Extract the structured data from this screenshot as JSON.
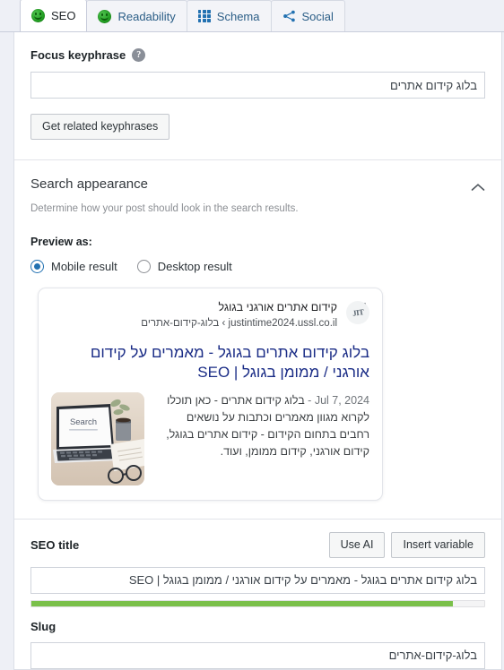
{
  "tabs": [
    {
      "id": "seo",
      "label": "SEO",
      "icon": "smiley-green-icon",
      "active": true
    },
    {
      "id": "readability",
      "label": "Readability",
      "icon": "smiley-green-icon",
      "active": false
    },
    {
      "id": "schema",
      "label": "Schema",
      "icon": "grid-icon",
      "active": false
    },
    {
      "id": "social",
      "label": "Social",
      "icon": "share-icon",
      "active": false
    }
  ],
  "focus_keyphrase": {
    "label": "Focus keyphrase",
    "help_icon": "help-circle-icon",
    "value": "בלוג קידום אתרים",
    "placeholder": "",
    "related_button": "Get related keyphrases"
  },
  "search_appearance": {
    "title": "Search appearance",
    "collapse_icon": "chevron-up-icon",
    "description": "Determine how your post should look in the search results.",
    "preview_as_label": "Preview as:",
    "options": [
      {
        "id": "mobile",
        "label": "Mobile result",
        "selected": true
      },
      {
        "id": "desktop",
        "label": "Desktop result",
        "selected": false
      }
    ]
  },
  "google_preview": {
    "favicon_text": "JIT",
    "site_name": "קידום אתרים אורגני בגוגל",
    "url": "justintime2024.ussl.co.il › בלוג-קידום-אתרים",
    "menu_icon": "more-vertical-icon",
    "title": "בלוג קידום אתרים בגוגל - מאמרים על קידום אורגני / ממומן בגוגל | SEO",
    "date": "Jul 7, 2024",
    "separator": "-",
    "snippet_lead": "בלוג קידום אתרים - כאן",
    "description": "תוכלו לקרוא מגוון מאמרים וכתבות על נושאים רחבים בתחום הקידום - קידום אתרים בגוגל, קידום אורגני, קידום ממומן, ועוד.",
    "thumbnail_alt": "laptop-search-photo"
  },
  "seo_title": {
    "label": "SEO title",
    "use_ai_button": "Use AI",
    "insert_variable_button": "Insert variable",
    "value": "בלוג קידום אתרים בגוגל - מאמרים על קידום אורגני / ממומן בגוגל | SEO",
    "placeholder": "",
    "progress_percent": 93,
    "progress_color": "#7ac04a"
  },
  "slug": {
    "label": "Slug",
    "value": "בלוג-קידום-אתרים",
    "placeholder": ""
  },
  "colors": {
    "accent": "#2271b1",
    "good_green": "#7ac04a",
    "link_blue": "#1a2c86",
    "page_bg": "#eef0f6"
  }
}
